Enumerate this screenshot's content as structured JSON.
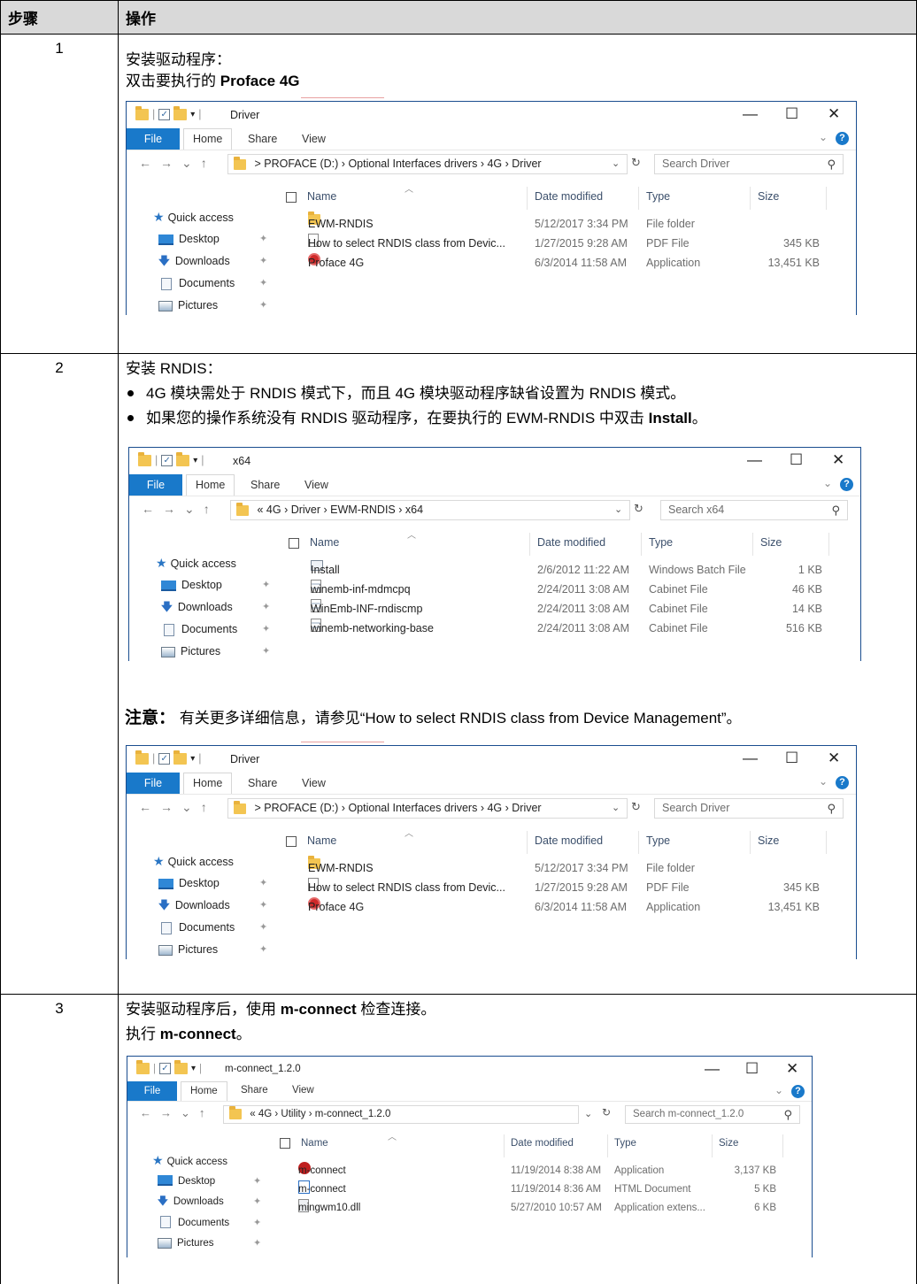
{
  "table": {
    "header": {
      "step": "步骤",
      "action": "操作"
    },
    "rows": [
      {
        "step": "1",
        "lines": [
          "安装驱动程序：",
          "双击要执行的 "
        ],
        "bold_target": "Proface 4G"
      },
      {
        "step": "2",
        "title": "安装 RNDIS：",
        "bullets": [
          "4G 模块需处于 RNDIS 模式下，而且 4G 模块驱动程序缺省设置为 RNDIS 模式。",
          "如果您的操作系统没有 RNDIS 驱动程序，在要执行的 EWM-RNDIS 中双击 "
        ],
        "bullet2_bold": "Install",
        "bullet2_end": "。",
        "note_label": "注意：",
        "note_text": "有关更多详细信息，请参见“How to select RNDIS class from Device Management”。"
      },
      {
        "step": "3",
        "line1_pre": "安装驱动程序后，使用 ",
        "line1_bold": "m-connect",
        "line1_post": " 检查连接。",
        "line2_pre": "执行 ",
        "line2_bold": "m-connect",
        "line2_post": "。"
      }
    ]
  },
  "windows": {
    "driver": {
      "title": "Driver",
      "tabs": {
        "file": "File",
        "home": "Home",
        "share": "Share",
        "view": "View"
      },
      "path": [
        "PROFACE (D:)",
        "Optional Interfaces drivers",
        "4G",
        "Driver"
      ],
      "path_prefix": ">",
      "search_placeholder": "Search Driver",
      "nav": [
        "Quick access",
        "Desktop",
        "Downloads",
        "Documents",
        "Pictures"
      ],
      "columns": [
        "Name",
        "Date modified",
        "Type",
        "Size"
      ],
      "files": [
        {
          "name": "EWM-RNDIS",
          "date": "5/12/2017 3:34 PM",
          "type": "File folder",
          "size": "",
          "icon": "folder-icon"
        },
        {
          "name": "How to select RNDIS class from Devic...",
          "date": "1/27/2015 9:28 AM",
          "type": "PDF File",
          "size": "345 KB",
          "icon": "pdf-file-icon"
        },
        {
          "name": "Proface 4G",
          "date": "6/3/2014 11:58 AM",
          "type": "Application",
          "size": "13,451 KB",
          "icon": "proface-app-icon"
        }
      ]
    },
    "x64": {
      "title": "x64",
      "tabs": {
        "file": "File",
        "home": "Home",
        "share": "Share",
        "view": "View"
      },
      "path": [
        "4G",
        "Driver",
        "EWM-RNDIS",
        "x64"
      ],
      "path_prefix": "«",
      "search_placeholder": "Search x64",
      "nav": [
        "Quick access",
        "Desktop",
        "Downloads",
        "Documents",
        "Pictures"
      ],
      "columns": [
        "Name",
        "Date modified",
        "Type",
        "Size"
      ],
      "files": [
        {
          "name": "Install",
          "date": "2/6/2012 11:22 AM",
          "type": "Windows Batch File",
          "size": "1 KB",
          "icon": "batch-file-icon"
        },
        {
          "name": "winemb-inf-mdmcpq",
          "date": "2/24/2011 3:08 AM",
          "type": "Cabinet File",
          "size": "46 KB",
          "icon": "cabinet-file-icon"
        },
        {
          "name": "WinEmb-INF-rndiscmp",
          "date": "2/24/2011 3:08 AM",
          "type": "Cabinet File",
          "size": "14 KB",
          "icon": "cabinet-file-icon"
        },
        {
          "name": "winemb-networking-base",
          "date": "2/24/2011 3:08 AM",
          "type": "Cabinet File",
          "size": "516 KB",
          "icon": "cabinet-file-icon"
        }
      ]
    },
    "mconnect": {
      "title": "m-connect_1.2.0",
      "tabs": {
        "file": "File",
        "home": "Home",
        "share": "Share",
        "view": "View"
      },
      "path": [
        "4G",
        "Utility",
        "m-connect_1.2.0"
      ],
      "path_prefix": "«",
      "search_placeholder": "Search m-connect_1.2.0",
      "nav": [
        "Quick access",
        "Desktop",
        "Downloads",
        "Documents",
        "Pictures"
      ],
      "columns": [
        "Name",
        "Date modified",
        "Type",
        "Size"
      ],
      "files": [
        {
          "name": "m-connect",
          "date": "11/19/2014 8:38 AM",
          "type": "Application",
          "size": "3,137 KB",
          "icon": "m-connect-app-icon"
        },
        {
          "name": "m-connect",
          "date": "11/19/2014 8:36 AM",
          "type": "HTML Document",
          "size": "5 KB",
          "icon": "html-document-icon"
        },
        {
          "name": "mingwm10.dll",
          "date": "5/27/2010 10:57 AM",
          "type": "Application extens...",
          "size": "6 KB",
          "icon": "dll-file-icon"
        }
      ]
    }
  }
}
